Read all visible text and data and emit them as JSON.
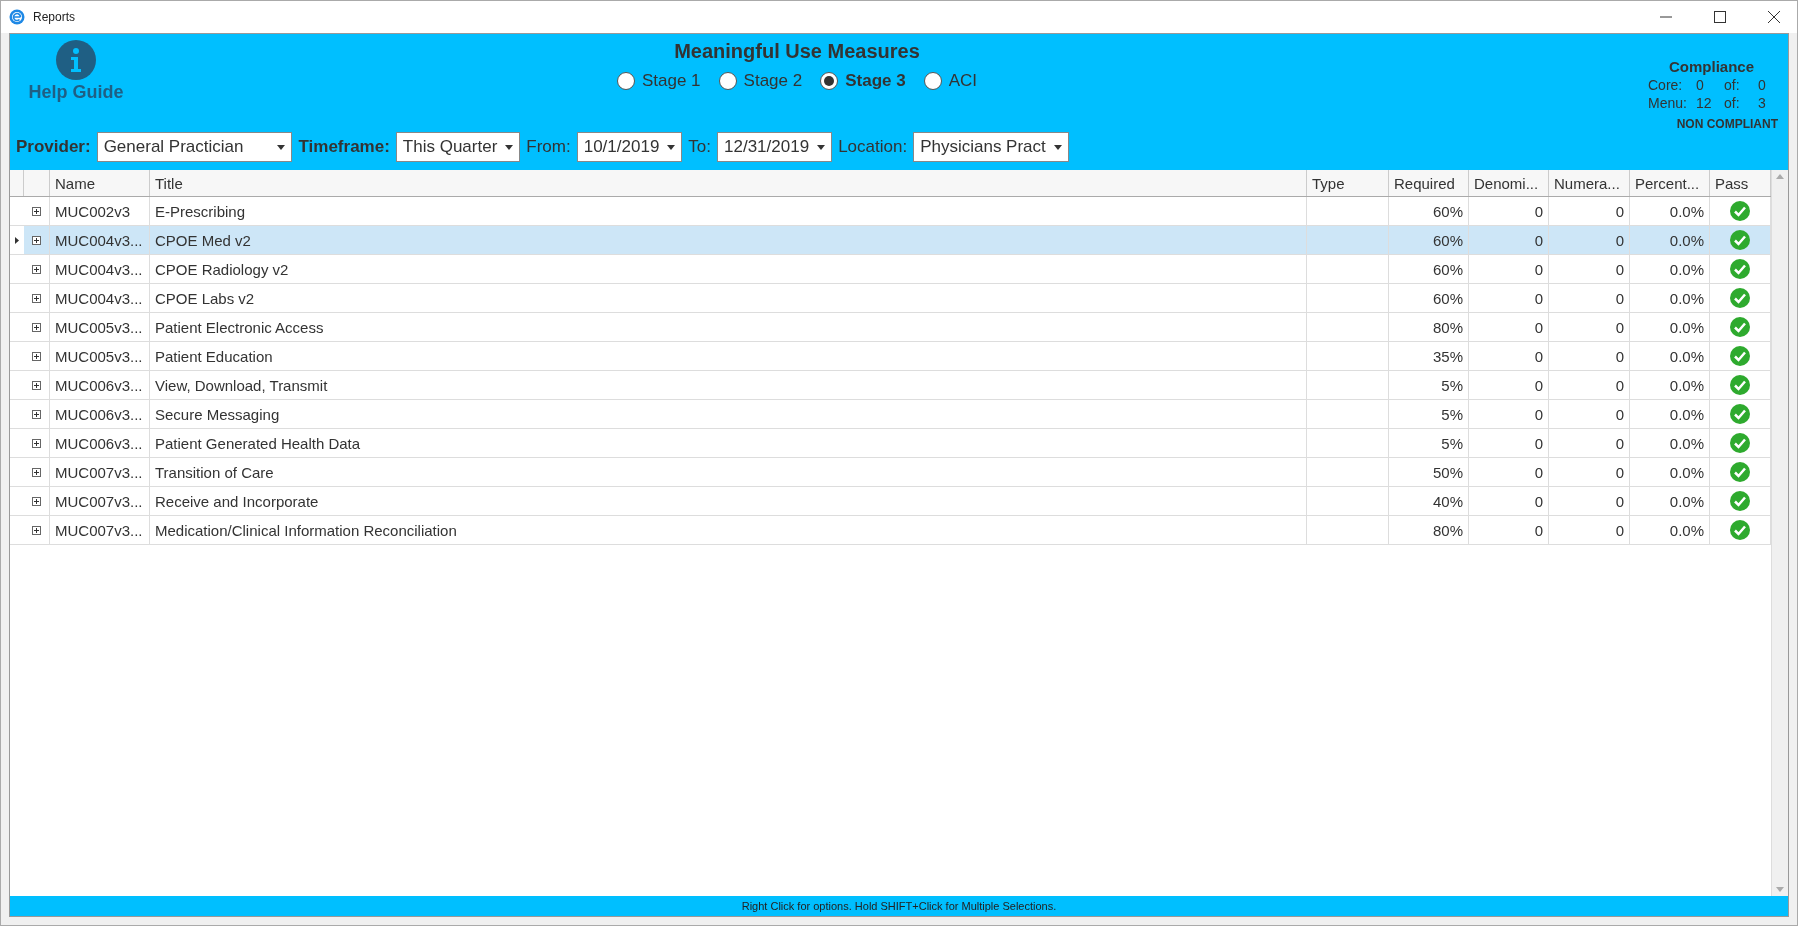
{
  "window": {
    "title": "Reports"
  },
  "help": {
    "label": "Help Guide"
  },
  "heading": "Meaningful Use Measures",
  "stages": [
    {
      "label": "Stage 1",
      "selected": false
    },
    {
      "label": "Stage 2",
      "selected": false
    },
    {
      "label": "Stage 3",
      "selected": true
    },
    {
      "label": "ACI",
      "selected": false
    }
  ],
  "filters": [
    {
      "label": "Provider:",
      "bold": true,
      "value": "General Practician"
    },
    {
      "label": "Timeframe:",
      "bold": true,
      "value": "This Quarter"
    },
    {
      "label": "From:",
      "bold": false,
      "value": "10/1/2019"
    },
    {
      "label": "To:",
      "bold": false,
      "value": "12/31/2019"
    },
    {
      "label": "Location:",
      "bold": false,
      "value": "Physicians Pract"
    }
  ],
  "compliance": {
    "title": "Compliance",
    "lines": [
      {
        "label": "Core:",
        "value": "0",
        "of_label": "of:",
        "of_value": "0"
      },
      {
        "label": "Menu:",
        "value": "12",
        "of_label": "of:",
        "of_value": "3"
      }
    ],
    "status": "NON COMPLIANT"
  },
  "table": {
    "columns": [
      "Name",
      "Title",
      "Type",
      "Required",
      "Denomi...",
      "Numera...",
      "Percent...",
      "Pass"
    ],
    "rows": [
      {
        "name": "MUC002v3",
        "title": "E-Prescribing",
        "required": "60%",
        "denominator": "0",
        "numerator": "0",
        "percent": "0.0%",
        "passed": true,
        "selected": false
      },
      {
        "name": "MUC004v3...",
        "title": "CPOE Med v2",
        "required": "60%",
        "denominator": "0",
        "numerator": "0",
        "percent": "0.0%",
        "passed": true,
        "selected": true
      },
      {
        "name": "MUC004v3...",
        "title": "CPOE Radiology v2",
        "required": "60%",
        "denominator": "0",
        "numerator": "0",
        "percent": "0.0%",
        "passed": true,
        "selected": false
      },
      {
        "name": "MUC004v3...",
        "title": "CPOE Labs v2",
        "required": "60%",
        "denominator": "0",
        "numerator": "0",
        "percent": "0.0%",
        "passed": true,
        "selected": false
      },
      {
        "name": "MUC005v3...",
        "title": "Patient Electronic Access",
        "required": "80%",
        "denominator": "0",
        "numerator": "0",
        "percent": "0.0%",
        "passed": true,
        "selected": false
      },
      {
        "name": "MUC005v3...",
        "title": "Patient Education",
        "required": "35%",
        "denominator": "0",
        "numerator": "0",
        "percent": "0.0%",
        "passed": true,
        "selected": false
      },
      {
        "name": "MUC006v3...",
        "title": "View, Download, Transmit",
        "required": "5%",
        "denominator": "0",
        "numerator": "0",
        "percent": "0.0%",
        "passed": true,
        "selected": false
      },
      {
        "name": "MUC006v3...",
        "title": "Secure Messaging",
        "required": "5%",
        "denominator": "0",
        "numerator": "0",
        "percent": "0.0%",
        "passed": true,
        "selected": false
      },
      {
        "name": "MUC006v3...",
        "title": "Patient Generated Health Data",
        "required": "5%",
        "denominator": "0",
        "numerator": "0",
        "percent": "0.0%",
        "passed": true,
        "selected": false
      },
      {
        "name": "MUC007v3...",
        "title": "Transition of Care",
        "required": "50%",
        "denominator": "0",
        "numerator": "0",
        "percent": "0.0%",
        "passed": true,
        "selected": false
      },
      {
        "name": "MUC007v3...",
        "title": "Receive and Incorporate",
        "required": "40%",
        "denominator": "0",
        "numerator": "0",
        "percent": "0.0%",
        "passed": true,
        "selected": false
      },
      {
        "name": "MUC007v3...",
        "title": "Medication/Clinical Information Reconciliation",
        "required": "80%",
        "denominator": "0",
        "numerator": "0",
        "percent": "0.0%",
        "passed": true,
        "selected": false
      }
    ]
  },
  "status_bar": "Right Click for options. Hold SHIFT+Click for Multiple Selections."
}
